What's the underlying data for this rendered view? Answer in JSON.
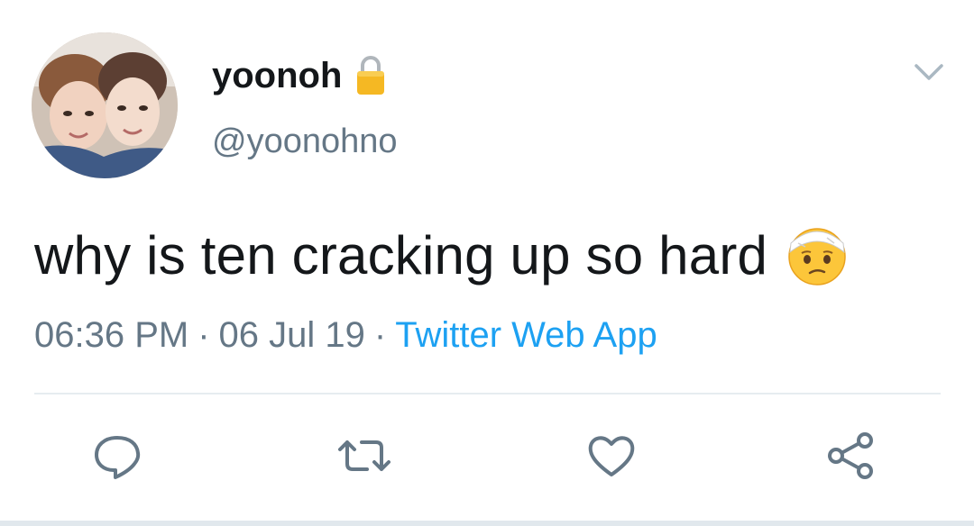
{
  "tweet": {
    "author": {
      "display_name": "yoonoh",
      "handle": "@yoonohno",
      "protected_icon": "lock-icon",
      "avatar": "two-people-photo"
    },
    "text": "why is ten cracking up so hard",
    "emoji": "face-with-head-bandage",
    "meta": {
      "time": "06:36 PM",
      "separator": "·",
      "date": "06 Jul 19",
      "source": "Twitter Web App"
    },
    "menu_icon": "chevron-down-icon"
  },
  "actions": [
    {
      "name": "reply",
      "icon": "speech-bubble-icon"
    },
    {
      "name": "retweet",
      "icon": "retweet-icon"
    },
    {
      "name": "like",
      "icon": "heart-icon"
    },
    {
      "name": "share",
      "icon": "share-icon"
    }
  ],
  "colors": {
    "text": "#14171a",
    "secondary": "#657786",
    "link": "#1da1f2",
    "divider": "#e6ecf0"
  }
}
